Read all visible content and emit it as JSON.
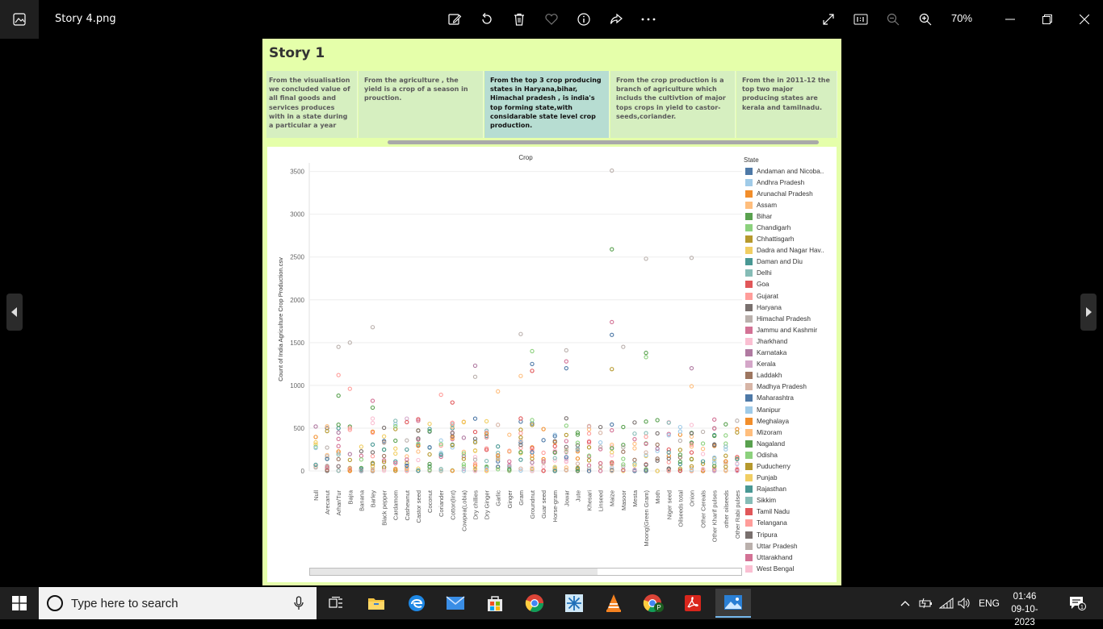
{
  "window": {
    "filename": "Story 4.png",
    "zoom": "70%",
    "toolbar_icons": [
      "edit-image-icon",
      "rotate-icon",
      "delete-icon",
      "favorite-icon",
      "info-icon",
      "share-icon",
      "more-icon"
    ],
    "right_icons": [
      "fullscreen-icon",
      "actual-size-icon",
      "zoom-out-icon",
      "zoom-in-icon"
    ]
  },
  "story": {
    "title": "Story 1",
    "captions": [
      "From the visualisation we concluded value of all final goods and services produces with in a state during a particular a year",
      "From  the  agriculture , the yield is a crop of a season in prouction.",
      "From  the top  3 crop producing states in Haryana,bihar, Himachal pradesh ,  is india's top forming state,with considarable state level crop production.",
      "From  the crop production is a branch of agriculture which includs the cultivtion of major tops crops in yield to castor-seeds,coriander.",
      "From the in 2011-12 the top two major producing states are kerala and tamilnadu."
    ],
    "active_caption": 2
  },
  "chart_data": {
    "type": "scatter",
    "title": "Crop",
    "ylabel": "Count of India Agriculture Crop Production.csv",
    "ylim": [
      0,
      3600
    ],
    "yticks": [
      "0",
      "500",
      "1000",
      "1500",
      "2000",
      "2500",
      "3000",
      "3500"
    ],
    "grid": true,
    "legend_title": "State",
    "legend_position": "right",
    "categories": [
      "Null",
      "Arecanut",
      "Arhar/Tur",
      "Bajra",
      "Banana",
      "Barley",
      "Black pepper",
      "Cardamom",
      "Cashewnut",
      "Castor seed",
      "Coconut",
      "Coriander",
      "Cotton(lint)",
      "Cowpea(Lobia)",
      "Dry chillies",
      "Dry Ginger",
      "Garlic",
      "Ginger",
      "Gram",
      "Groundnut",
      "Guar seed",
      "Horse-gram",
      "Jowar",
      "Jute",
      "Khesari",
      "Linseed",
      "Maize",
      "Masoor",
      "Mesta",
      "Moong(Green Gram)",
      "Moth",
      "Niger seed",
      "Oilseeds total",
      "Onion",
      "Other Cereals",
      "Other Kharif pulses",
      "other oilseeds",
      "Other Rabi pulses"
    ],
    "states": [
      {
        "name": "Andaman and Nicoba..",
        "color": "#4e79a7"
      },
      {
        "name": "Andhra Pradesh",
        "color": "#a0cbe8"
      },
      {
        "name": "Arunachal Pradesh",
        "color": "#f28e2b"
      },
      {
        "name": "Assam",
        "color": "#ffbe7d"
      },
      {
        "name": "Bihar",
        "color": "#59a14f"
      },
      {
        "name": "Chandigarh",
        "color": "#8cd17d"
      },
      {
        "name": "Chhattisgarh",
        "color": "#b6992d"
      },
      {
        "name": "Dadra and Nagar Hav..",
        "color": "#f1ce63"
      },
      {
        "name": "Daman and Diu",
        "color": "#499894"
      },
      {
        "name": "Delhi",
        "color": "#86bcb6"
      },
      {
        "name": "Goa",
        "color": "#e15759"
      },
      {
        "name": "Gujarat",
        "color": "#ff9d9a"
      },
      {
        "name": "Haryana",
        "color": "#79706e"
      },
      {
        "name": "Himachal Pradesh",
        "color": "#bab0ac"
      },
      {
        "name": "Jammu and Kashmir",
        "color": "#d37295"
      },
      {
        "name": "Jharkhand",
        "color": "#fabfd2"
      },
      {
        "name": "Karnataka",
        "color": "#b07aa1"
      },
      {
        "name": "Kerala",
        "color": "#d4a6c8"
      },
      {
        "name": "Laddakh",
        "color": "#9d7660"
      },
      {
        "name": "Madhya Pradesh",
        "color": "#d7b5a6"
      },
      {
        "name": "Maharashtra",
        "color": "#4e79a7"
      },
      {
        "name": "Manipur",
        "color": "#a0cbe8"
      },
      {
        "name": "Meghalaya",
        "color": "#f28e2b"
      },
      {
        "name": "Mizoram",
        "color": "#ffbe7d"
      },
      {
        "name": "Nagaland",
        "color": "#59a14f"
      },
      {
        "name": "Odisha",
        "color": "#8cd17d"
      },
      {
        "name": "Puducherry",
        "color": "#b6992d"
      },
      {
        "name": "Punjab",
        "color": "#f1ce63"
      },
      {
        "name": "Rajasthan",
        "color": "#499894"
      },
      {
        "name": "Sikkim",
        "color": "#86bcb6"
      },
      {
        "name": "Tamil Nadu",
        "color": "#e15759"
      },
      {
        "name": "Telangana",
        "color": "#ff9d9a"
      },
      {
        "name": "Tripura",
        "color": "#79706e"
      },
      {
        "name": "Uttar Pradesh",
        "color": "#bab0ac"
      },
      {
        "name": "Uttarakhand",
        "color": "#d37295"
      },
      {
        "name": "West Bengal",
        "color": "#fabfd2"
      }
    ],
    "highlights": [
      {
        "crop": "Arhar/Tur",
        "value": 1450,
        "state": "Himachal Pradesh"
      },
      {
        "crop": "Arhar/Tur",
        "value": 1120,
        "state": "Gujarat"
      },
      {
        "crop": "Arhar/Tur",
        "value": 880,
        "state": "Bihar"
      },
      {
        "crop": "Bajra",
        "value": 1500,
        "state": "Himachal Pradesh"
      },
      {
        "crop": "Bajra",
        "value": 960,
        "state": "Gujarat"
      },
      {
        "crop": "Barley",
        "value": 1680,
        "state": "Himachal Pradesh"
      },
      {
        "crop": "Barley",
        "value": 820,
        "state": "Jammu and Kashmir"
      },
      {
        "crop": "Barley",
        "value": 740,
        "state": "Bihar"
      },
      {
        "crop": "Coriander",
        "value": 890,
        "state": "Gujarat"
      },
      {
        "crop": "Cotton(lint)",
        "value": 800,
        "state": "Tamil Nadu"
      },
      {
        "crop": "Dry chillies",
        "value": 1230,
        "state": "Karnataka"
      },
      {
        "crop": "Dry chillies",
        "value": 1100,
        "state": "Himachal Pradesh"
      },
      {
        "crop": "Garlic",
        "value": 930,
        "state": "Assam"
      },
      {
        "crop": "Gram",
        "value": 1600,
        "state": "Himachal Pradesh"
      },
      {
        "crop": "Gram",
        "value": 1110,
        "state": "Assam"
      },
      {
        "crop": "Groundnut",
        "value": 1400,
        "state": "Chandigarh"
      },
      {
        "crop": "Groundnut",
        "value": 1250,
        "state": "Maharashtra"
      },
      {
        "crop": "Groundnut",
        "value": 1170,
        "state": "Tamil Nadu"
      },
      {
        "crop": "Jowar",
        "value": 1410,
        "state": "Himachal Pradesh"
      },
      {
        "crop": "Jowar",
        "value": 1280,
        "state": "Jammu and Kashmir"
      },
      {
        "crop": "Jowar",
        "value": 1200,
        "state": "Andaman and Nicoba.."
      },
      {
        "crop": "Maize",
        "value": 3510,
        "state": "Himachal Pradesh"
      },
      {
        "crop": "Maize",
        "value": 2590,
        "state": "Bihar"
      },
      {
        "crop": "Maize",
        "value": 1740,
        "state": "Jammu and Kashmir"
      },
      {
        "crop": "Maize",
        "value": 1590,
        "state": "Andaman and Nicoba.."
      },
      {
        "crop": "Maize",
        "value": 1190,
        "state": "Chhattisgarh"
      },
      {
        "crop": "Masoor",
        "value": 1450,
        "state": "Himachal Pradesh"
      },
      {
        "crop": "Moong(Green Gram)",
        "value": 2480,
        "state": "Himachal Pradesh"
      },
      {
        "crop": "Moong(Green Gram)",
        "value": 1380,
        "state": "Bihar"
      },
      {
        "crop": "Moong(Green Gram)",
        "value": 1330,
        "state": "Chandigarh"
      },
      {
        "crop": "Onion",
        "value": 2490,
        "state": "Himachal Pradesh"
      },
      {
        "crop": "Onion",
        "value": 1200,
        "state": "Karnataka"
      },
      {
        "crop": "Onion",
        "value": 990,
        "state": "Assam"
      }
    ]
  },
  "taskbar": {
    "search_placeholder": "Type here to search",
    "apps": [
      "task-view-icon",
      "file-explorer-icon",
      "edge-icon",
      "mail-icon",
      "store-icon",
      "chrome-icon",
      "snowflake-app-icon",
      "vlc-icon",
      "chrome-profile-icon",
      "acrobat-icon",
      "photos-icon"
    ],
    "language": "ENG",
    "time": "01:46",
    "date": "09-10-2023",
    "notifications": "1"
  }
}
